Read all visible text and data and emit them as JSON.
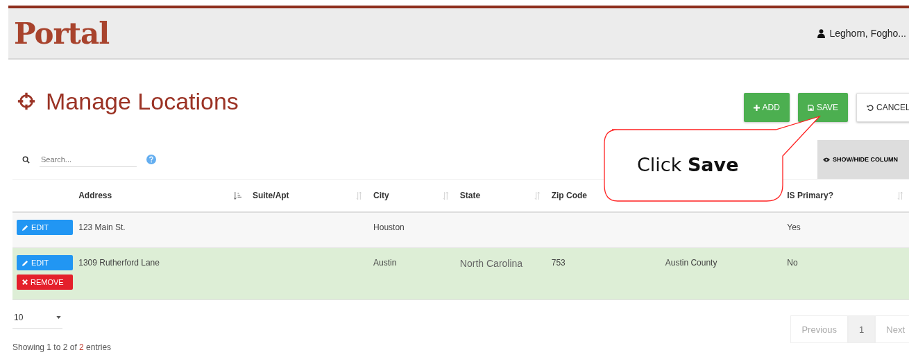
{
  "header": {
    "logo": "Portal",
    "user": "Leghorn, Fogho..."
  },
  "page": {
    "title": "Manage Locations"
  },
  "actions": [
    {
      "label": "ADD",
      "kind": "add"
    },
    {
      "label": "SAVE",
      "kind": "save"
    },
    {
      "label": "CANCEL",
      "kind": "cancel"
    }
  ],
  "search": {
    "placeholder": "Search..."
  },
  "column_toggle": {
    "label": "SHOW/HIDE COLUMN"
  },
  "table": {
    "columns": [
      {
        "label": "Address",
        "sorted": true
      },
      {
        "label": "Suite/Apt",
        "sorted": false
      },
      {
        "label": "City",
        "sorted": false
      },
      {
        "label": "State",
        "sorted": false
      },
      {
        "label": "Zip Code"
      },
      null,
      {
        "label": "IS Primary?",
        "sorted": false
      }
    ],
    "rows": [
      {
        "selected": false,
        "buttons": [
          {
            "label": "EDIT",
            "kind": "edit"
          }
        ],
        "cells": [
          "123 Main St.",
          "",
          "Houston",
          "",
          "",
          "",
          "Yes"
        ]
      },
      {
        "selected": true,
        "buttons": [
          {
            "label": "EDIT",
            "kind": "edit"
          },
          {
            "label": "REMOVE",
            "kind": "remove"
          }
        ],
        "cells": [
          "1309 Rutherford Lane",
          "",
          "Austin",
          "North Carolina",
          "753",
          "Austin County",
          "No"
        ]
      }
    ]
  },
  "page_size": {
    "value": "10"
  },
  "info": [
    {
      "text": "Showing 1 to 2 of ",
      "highlight": false
    },
    {
      "text": "2",
      "highlight": true
    },
    {
      "text": " entries",
      "highlight": false
    }
  ],
  "pagination": [
    {
      "label": "Previous",
      "selected": false
    },
    {
      "label": "1",
      "selected": true
    },
    {
      "label": "Next",
      "selected": false
    }
  ],
  "callout": {
    "text": "Click **Save**"
  }
}
